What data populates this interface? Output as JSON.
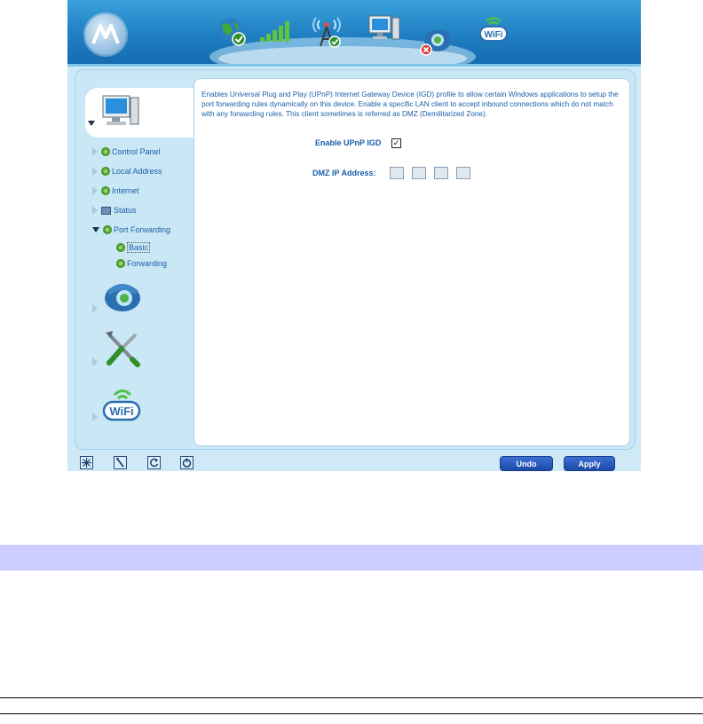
{
  "description": "Enables Universal Plug and Play (UPnP) Internet Gateway Device (IGD) profile to allow certain Windows applications to setup the port forwarding rules dynamically on this device. Enable a specific LAN client to accept inbound connections which do not match with any forwarding rules. This client sometimes is referred as DMZ (Demilitarized Zone).",
  "form": {
    "upnp_label": "Enable UPnP IGD",
    "upnp_checked": true,
    "upnp_mark": "✓",
    "dmz_label": "DMZ IP Address:",
    "dmz_octets": [
      "",
      "",
      "",
      ""
    ]
  },
  "sidebar": {
    "items": [
      {
        "label": "Control Panel",
        "icon": "gear-icon"
      },
      {
        "label": "Local Address",
        "icon": "gear-icon"
      },
      {
        "label": "Internet",
        "icon": "gear-icon"
      },
      {
        "label": "Status",
        "icon": "status-icon"
      },
      {
        "label": "Port Forwarding",
        "icon": "gear-icon",
        "expanded": true
      }
    ],
    "sub_items": [
      {
        "label": "Basic",
        "selected": true
      },
      {
        "label": "Forwarding"
      }
    ],
    "categories": [
      "computer-icon",
      "telephone-icon",
      "tools-icon",
      "wifi-icon"
    ]
  },
  "top_nav": {
    "icons": [
      "globe-check-icon",
      "signal-bars-icon",
      "antenna-icon",
      "computer-icon",
      "phone-status-icon",
      "wifi-icon"
    ]
  },
  "buttons": {
    "undo": "Undo",
    "apply": "Apply"
  },
  "toolbar_icons": [
    "wizard-icon",
    "tools-icon",
    "refresh-icon",
    "logout-icon"
  ],
  "colors": {
    "link": "#1a5fa8",
    "header": "#1f7fc2",
    "panel": "#c9e7f5",
    "button": "#1d49a6",
    "band": "#ccccff"
  }
}
